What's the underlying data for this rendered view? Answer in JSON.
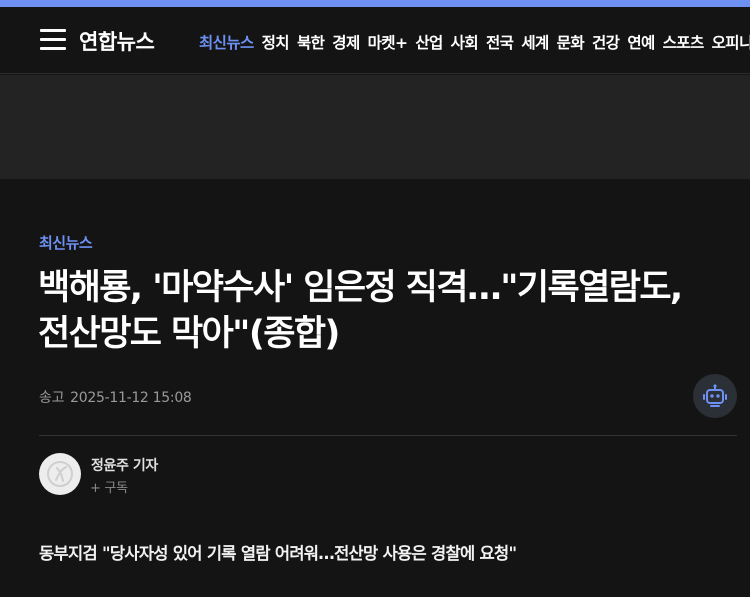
{
  "header": {
    "logo_text": "연합뉴스",
    "nav": [
      "최신뉴스",
      "정치",
      "북한",
      "경제",
      "마켓+",
      "산업",
      "사회",
      "전국",
      "세계",
      "문화",
      "건강",
      "연예",
      "스포츠",
      "오피니언"
    ],
    "active_nav": "최신뉴스"
  },
  "article": {
    "category": "최신뉴스",
    "headline_line1": "백해룡, '마약수사' 임은정 직격…\"기록열람도,",
    "headline_line2": "전산망도 막아\"(종합)",
    "sent_label": "송고",
    "sent_time": "2025-11-12 15:08",
    "author_name": "정윤주 기자",
    "subscribe_label": "+ 구독",
    "subheadline": "동부지검 \"당사자성 있어 기록 열람 어려워…전산망 사용은 경찰에 요청\""
  },
  "icons": {
    "menu": "hamburger-menu-icon",
    "robot": "robot-icon",
    "avatar": "author-avatar-icon"
  },
  "colors": {
    "accent": "#6d90f2",
    "background": "#141414",
    "ad_band": "#232323"
  }
}
